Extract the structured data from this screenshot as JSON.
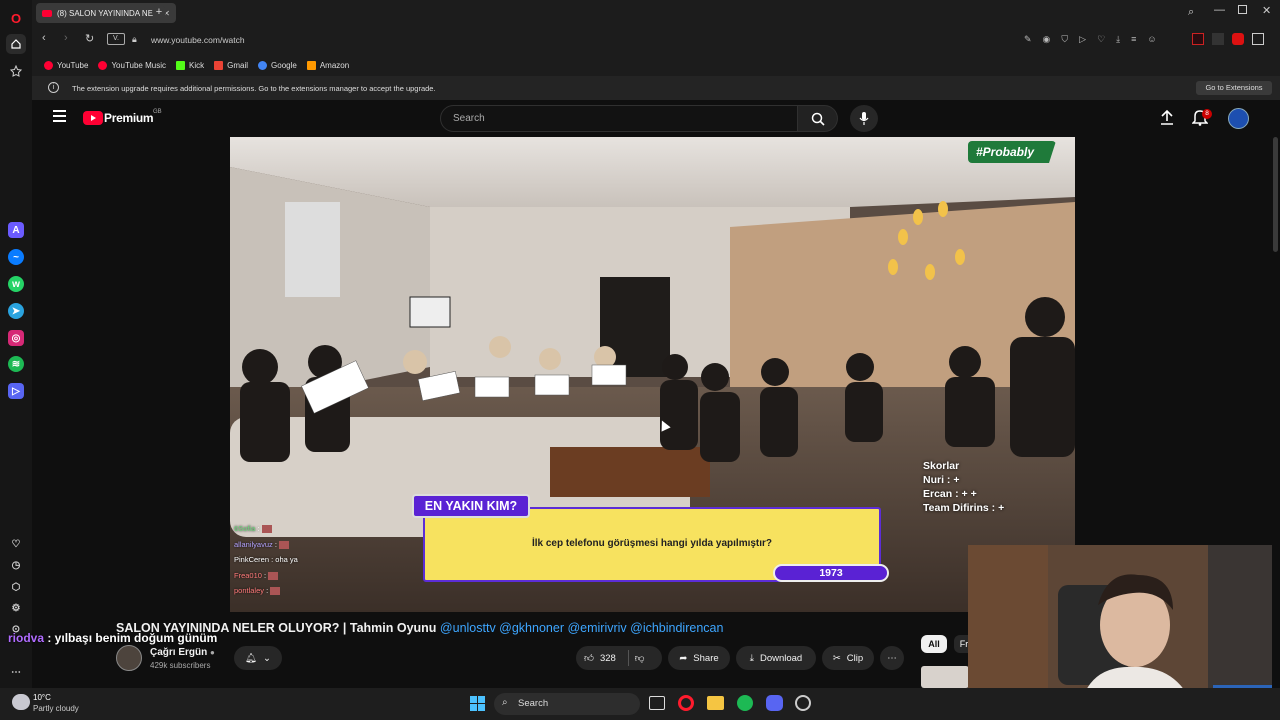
{
  "browser": {
    "tab_title": "(8) SALON YAYININDA NE",
    "url": "www.youtube.com/watch",
    "url_badge": "V.",
    "bookmarks": [
      {
        "label": "YouTube",
        "color": "#ff0033"
      },
      {
        "label": "YouTube Music",
        "color": "#ff0033"
      },
      {
        "label": "Kick",
        "color": "#53fc18"
      },
      {
        "label": "Gmail",
        "color": "#ea4335"
      },
      {
        "label": "Google",
        "color": "#4285f4"
      },
      {
        "label": "Amazon",
        "color": "#ff9900"
      }
    ],
    "infobar_text": "The extension upgrade requires additional permissions. Go to the extensions manager to accept the upgrade.",
    "infobar_button": "Go to Extensions"
  },
  "youtube": {
    "logo_text": "Premium",
    "region": "GB",
    "search_placeholder": "Search",
    "notification_count": "8"
  },
  "video": {
    "tag": "#Probably",
    "scoreboard": {
      "title": "Skorlar",
      "rows": [
        "Nuri : +",
        "Ercan : + +",
        "Team Difirins : +"
      ]
    },
    "quiz": {
      "header": "EN YAKIN KIM?",
      "question": "İlk cep telefonu görüşmesi hangi yılda yapılmıştır?",
      "answer": "1973"
    },
    "stream_chat": [
      {
        "user": "6Sofia",
        "msg": "",
        "color": "#6cd67a"
      },
      {
        "user": "allanilyavuz",
        "msg": "",
        "color": "#b4a3ff"
      },
      {
        "user": "PinkCeren",
        "msg": "oha ya",
        "color": "#ffffff"
      },
      {
        "user": "Frea010",
        "msg": "",
        "color": "#ff7a7a"
      },
      {
        "user": "pontlaley",
        "msg": "",
        "color": "#ff7a7a"
      }
    ]
  },
  "title": {
    "main": "SALON YAYININDA NELER OLUYOR? | Tahmin Oyunu",
    "tags": "@unlosttv @gkhnoner @emirivriv @ichbindirencan"
  },
  "overlay_chat": {
    "user": "riodva",
    "msg": " : yılbaşı benim doğum günüm"
  },
  "channel": {
    "name": "Çağrı Ergün",
    "subscribers": "429k subscribers"
  },
  "actions": {
    "likes": "328",
    "share": "Share",
    "download": "Download",
    "clip": "Clip"
  },
  "chips": {
    "all": "All",
    "next": "Fr"
  },
  "taskbar": {
    "weather_temp": "10°C",
    "weather_desc": "Partly cloudy",
    "search": "Search"
  }
}
